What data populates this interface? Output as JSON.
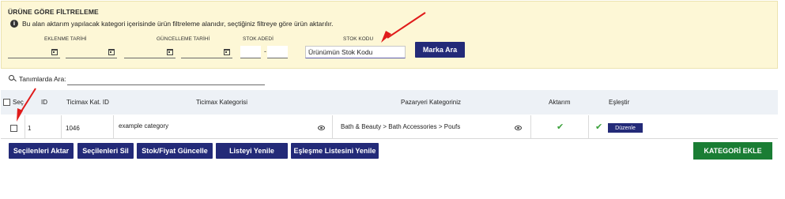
{
  "filter": {
    "title": "ÜRÜNE GÖRE FİLTRELEME",
    "info_icon": "i",
    "info_text": "Bu alan aktarım yapılacak kategori içerisinde ürün filtreleme alanıdır, seçtiğiniz filtreye göre ürün aktarılır.",
    "labels": {
      "created_date": "EKLENME TARİHİ",
      "updated_date": "GÜNCELLEME TARİHİ",
      "stock_count": "STOK ADEDİ",
      "stock_code": "STOK KODU"
    },
    "stock_dash": "-",
    "stock_code_value": "Ürünümün Stok Kodu",
    "brand_search_button": "Marka Ara"
  },
  "search": {
    "label": "Tanımlarda Ara:"
  },
  "table": {
    "headers": {
      "select": "Seç",
      "id": "ID",
      "ticimax_cat_id": "Ticimax Kat. ID",
      "ticimax_category": "Ticimax Kategorisi",
      "marketplace_category": "Pazaryeri Kategoriniz",
      "transferred": "Aktarım",
      "match": "Eşleştir"
    },
    "rows": [
      {
        "id": "1",
        "ticimax_cat_id": "1046",
        "ticimax_category": "example category",
        "marketplace_category": "Bath & Beauty > Bath Accessories > Poufs",
        "edit_label": "Düzenle"
      }
    ]
  },
  "actions": {
    "transfer_selected": "Seçilenleri Aktar",
    "delete_selected": "Seçilenleri Sil",
    "stock_price_update": "Stok/Fiyat Güncelle",
    "refresh_list": "Listeyi Yenile",
    "refresh_match_list": "Eşleşme Listesini Yenile",
    "add_category": "KATEGORİ EKLE"
  },
  "colors": {
    "panel_bg": "#fdf7d6",
    "primary_button": "#232a78",
    "add_button": "#1a7d34",
    "header_bg": "#edf1f6",
    "check": "#3aa13a",
    "annotation_arrow": "#e01b1b"
  }
}
